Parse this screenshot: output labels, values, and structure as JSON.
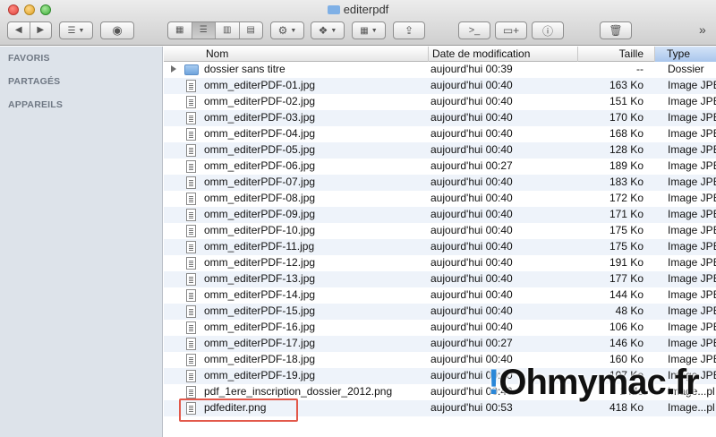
{
  "window": {
    "title": "editerpdf"
  },
  "toolbar": {
    "back_icon": "chevron-left-icon",
    "forward_icon": "chevron-right-icon",
    "arrange_icon": "list-arrange-icon",
    "quicklook_icon": "eye-icon",
    "view_icons": [
      "icon-view-icon",
      "list-view-icon",
      "column-view-icon",
      "coverflow-view-icon"
    ],
    "action_icon": "gear-icon",
    "dropbox_icon": "dropbox-icon",
    "arrange2_icon": "grid-arrange-icon",
    "share_icon": "share-icon",
    "terminal_icon": "terminal-icon",
    "newfolder_icon": "new-folder-icon",
    "info_icon": "info-icon",
    "trash_icon": "trash-icon",
    "overflow": "»"
  },
  "sidebar": {
    "sections": [
      "FAVORIS",
      "PARTAGÉS",
      "APPAREILS"
    ]
  },
  "columns": {
    "name": "Nom",
    "date": "Date de modification",
    "size": "Taille",
    "type": "Type"
  },
  "files": [
    {
      "name": "dossier sans titre",
      "date": "aujourd'hui 00:39",
      "size": "--",
      "type": "Dossier",
      "kind": "folder"
    },
    {
      "name": "omm_editerPDF-01.jpg",
      "date": "aujourd'hui 00:40",
      "size": "163 Ko",
      "type": "Image JPEG",
      "kind": "file"
    },
    {
      "name": "omm_editerPDF-02.jpg",
      "date": "aujourd'hui 00:40",
      "size": "151 Ko",
      "type": "Image JPEG",
      "kind": "file"
    },
    {
      "name": "omm_editerPDF-03.jpg",
      "date": "aujourd'hui 00:40",
      "size": "170 Ko",
      "type": "Image JPEG",
      "kind": "file"
    },
    {
      "name": "omm_editerPDF-04.jpg",
      "date": "aujourd'hui 00:40",
      "size": "168 Ko",
      "type": "Image JPEG",
      "kind": "file"
    },
    {
      "name": "omm_editerPDF-05.jpg",
      "date": "aujourd'hui 00:40",
      "size": "128 Ko",
      "type": "Image JPEG",
      "kind": "file"
    },
    {
      "name": "omm_editerPDF-06.jpg",
      "date": "aujourd'hui 00:27",
      "size": "189 Ko",
      "type": "Image JPEG",
      "kind": "file"
    },
    {
      "name": "omm_editerPDF-07.jpg",
      "date": "aujourd'hui 00:40",
      "size": "183 Ko",
      "type": "Image JPEG",
      "kind": "file"
    },
    {
      "name": "omm_editerPDF-08.jpg",
      "date": "aujourd'hui 00:40",
      "size": "172 Ko",
      "type": "Image JPEG",
      "kind": "file"
    },
    {
      "name": "omm_editerPDF-09.jpg",
      "date": "aujourd'hui 00:40",
      "size": "171 Ko",
      "type": "Image JPEG",
      "kind": "file"
    },
    {
      "name": "omm_editerPDF-10.jpg",
      "date": "aujourd'hui 00:40",
      "size": "175 Ko",
      "type": "Image JPEG",
      "kind": "file"
    },
    {
      "name": "omm_editerPDF-11.jpg",
      "date": "aujourd'hui 00:40",
      "size": "175 Ko",
      "type": "Image JPEG",
      "kind": "file"
    },
    {
      "name": "omm_editerPDF-12.jpg",
      "date": "aujourd'hui 00:40",
      "size": "191 Ko",
      "type": "Image JPEG",
      "kind": "file"
    },
    {
      "name": "omm_editerPDF-13.jpg",
      "date": "aujourd'hui 00:40",
      "size": "177 Ko",
      "type": "Image JPEG",
      "kind": "file"
    },
    {
      "name": "omm_editerPDF-14.jpg",
      "date": "aujourd'hui 00:40",
      "size": "144 Ko",
      "type": "Image JPEG",
      "kind": "file"
    },
    {
      "name": "omm_editerPDF-15.jpg",
      "date": "aujourd'hui 00:40",
      "size": "48 Ko",
      "type": "Image JPEG",
      "kind": "file"
    },
    {
      "name": "omm_editerPDF-16.jpg",
      "date": "aujourd'hui 00:40",
      "size": "106 Ko",
      "type": "Image JPEG",
      "kind": "file"
    },
    {
      "name": "omm_editerPDF-17.jpg",
      "date": "aujourd'hui 00:27",
      "size": "146 Ko",
      "type": "Image JPEG",
      "kind": "file"
    },
    {
      "name": "omm_editerPDF-18.jpg",
      "date": "aujourd'hui 00:40",
      "size": "160 Ko",
      "type": "Image JPEG",
      "kind": "file"
    },
    {
      "name": "omm_editerPDF-19.jpg",
      "date": "aujourd'hui 00:40",
      "size": "107 Ko",
      "type": "Image JPEG",
      "kind": "file"
    },
    {
      "name": "pdf_1ere_inscription_dossier_2012.png",
      "date": "aujourd'hui 00:40",
      "size": "1 Mo",
      "type": "Image...pl",
      "kind": "file"
    },
    {
      "name": "pdfediter.png",
      "date": "aujourd'hui 00:53",
      "size": "418 Ko",
      "type": "Image...pl",
      "kind": "file"
    }
  ],
  "watermark": {
    "excl": "!",
    "text": "Ohmymac.fr"
  },
  "colors": {
    "sidebar_bg": "#dde3ea",
    "row_alt": "#eef3fa",
    "sort_column": "#a9c6ec",
    "highlight_box": "#e2584a",
    "watermark_accent": "#2a87d8"
  }
}
